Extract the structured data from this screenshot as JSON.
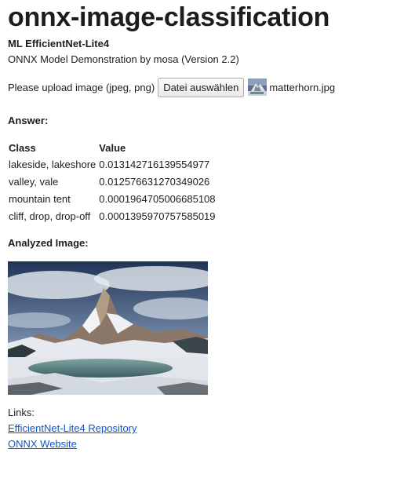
{
  "app": {
    "title": "onnx-image-classification",
    "model_name": "ML EfficientNet-Lite4",
    "description": "ONNX Model Demonstration by mosa (Version 2.2)"
  },
  "upload": {
    "label": "Please upload image (jpeg, png)",
    "button_label": "Datei auswählen",
    "file_name": "matterhorn.jpg",
    "file_icon": "image-thumbnail-icon"
  },
  "answer": {
    "heading": "Answer:",
    "columns": [
      "Class",
      "Value"
    ],
    "rows": [
      [
        "lakeside, lakeshore",
        "0.013142716139554977"
      ],
      [
        "valley, vale",
        "0.012576631270349026"
      ],
      [
        "mountain tent",
        "0.0001964705006685108"
      ],
      [
        "cliff, drop, drop-off",
        "0.0001395970757585019"
      ]
    ]
  },
  "analyzed": {
    "heading": "Analyzed Image:"
  },
  "links": {
    "label": "Links:",
    "items": [
      {
        "label": "EfficientNet-Lite4 Repository"
      },
      {
        "label": "ONNX Website"
      }
    ]
  },
  "colors": {
    "link": "#0b57d0",
    "text": "#1d1d1f"
  }
}
